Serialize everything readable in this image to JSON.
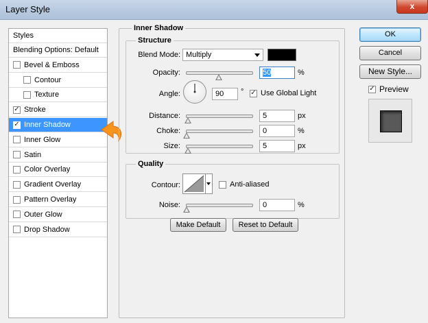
{
  "window": {
    "title": "Layer Style",
    "close_label": "x"
  },
  "styles_list": {
    "header": "Styles",
    "items": [
      {
        "label": "Blending Options: Default",
        "checkbox": false,
        "checked": false,
        "indent": false,
        "selected": false
      },
      {
        "label": "Bevel & Emboss",
        "checkbox": true,
        "checked": false,
        "indent": false,
        "selected": false
      },
      {
        "label": "Contour",
        "checkbox": true,
        "checked": false,
        "indent": true,
        "selected": false
      },
      {
        "label": "Texture",
        "checkbox": true,
        "checked": false,
        "indent": true,
        "selected": false
      },
      {
        "label": "Stroke",
        "checkbox": true,
        "checked": true,
        "indent": false,
        "selected": false
      },
      {
        "label": "Inner Shadow",
        "checkbox": true,
        "checked": true,
        "indent": false,
        "selected": true
      },
      {
        "label": "Inner Glow",
        "checkbox": true,
        "checked": false,
        "indent": false,
        "selected": false
      },
      {
        "label": "Satin",
        "checkbox": true,
        "checked": false,
        "indent": false,
        "selected": false
      },
      {
        "label": "Color Overlay",
        "checkbox": true,
        "checked": false,
        "indent": false,
        "selected": false
      },
      {
        "label": "Gradient Overlay",
        "checkbox": true,
        "checked": false,
        "indent": false,
        "selected": false
      },
      {
        "label": "Pattern Overlay",
        "checkbox": true,
        "checked": false,
        "indent": false,
        "selected": false
      },
      {
        "label": "Outer Glow",
        "checkbox": true,
        "checked": false,
        "indent": false,
        "selected": false
      },
      {
        "label": "Drop Shadow",
        "checkbox": true,
        "checked": false,
        "indent": false,
        "selected": false
      }
    ]
  },
  "inner_shadow": {
    "title": "Inner Shadow",
    "structure": {
      "title": "Structure",
      "blend_mode": {
        "label": "Blend Mode:",
        "value": "Multiply",
        "color": "#000000"
      },
      "opacity": {
        "label": "Opacity:",
        "value": "50",
        "unit": "%",
        "level": 0.5
      },
      "angle": {
        "label": "Angle:",
        "value": "90",
        "unit": "°",
        "use_global_light": {
          "label": "Use Global Light",
          "checked": true
        }
      },
      "distance": {
        "label": "Distance:",
        "value": "5",
        "unit": "px",
        "level": 0.02
      },
      "choke": {
        "label": "Choke:",
        "value": "0",
        "unit": "%",
        "level": 0.0
      },
      "size": {
        "label": "Size:",
        "value": "5",
        "unit": "px",
        "level": 0.02
      }
    },
    "quality": {
      "title": "Quality",
      "contour": {
        "label": "Contour:",
        "anti_aliased": {
          "label": "Anti-aliased",
          "checked": false
        }
      },
      "noise": {
        "label": "Noise:",
        "value": "0",
        "unit": "%",
        "level": 0.0
      }
    },
    "buttons": {
      "make_default": "Make Default",
      "reset_to_default": "Reset to Default"
    }
  },
  "right_panel": {
    "ok": "OK",
    "cancel": "Cancel",
    "new_style": "New Style...",
    "preview": {
      "label": "Preview",
      "checked": true
    }
  },
  "colors": {
    "selection": "#3d95ff",
    "arrow": "#f7941d"
  }
}
